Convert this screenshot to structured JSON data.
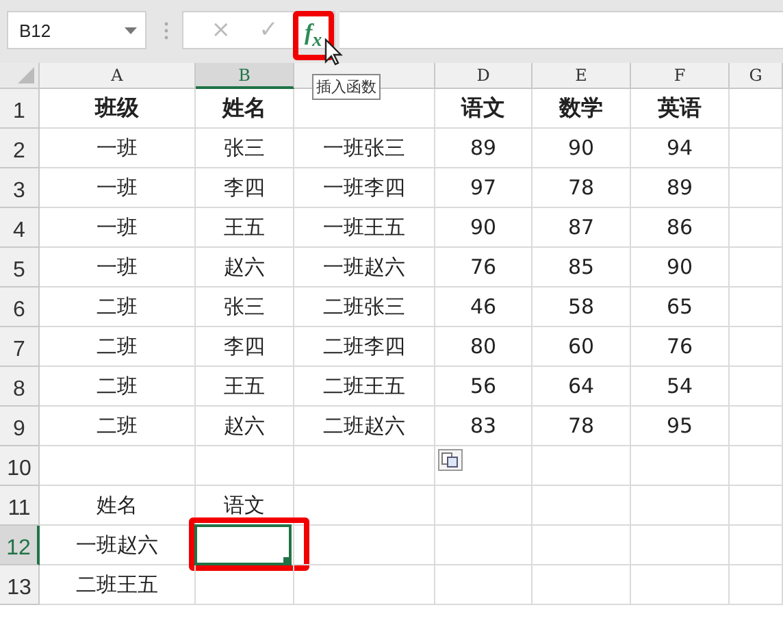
{
  "name_box": {
    "value": "B12"
  },
  "formula_bar": {
    "cancel": "×",
    "enter": "✓",
    "function_button": {
      "label": "f$_{x}$",
      "highlighted": true
    },
    "tooltip": "插入函数"
  },
  "selection": {
    "highlighted": true
  },
  "columns": [
    {
      "label": "A",
      "selected": false
    },
    {
      "label": "B",
      "selected": true
    },
    {
      "selected": false
    },
    {
      "label": "D",
      "selected": false
    },
    {
      "label": "E",
      "selected": false
    },
    {
      "label": "F",
      "selected": false
    },
    {
      "label": "G",
      "selected": false
    }
  ],
  "rows": [
    {
      "number": "1",
      "selected": false,
      "kind": "header",
      "cells": [
        "班级",
        "姓名",
        null,
        "语文",
        "数学",
        "英语",
        null
      ]
    },
    {
      "number": "2",
      "selected": false,
      "kind": "data",
      "cells": [
        "一班",
        "张三",
        "一班张三",
        "89",
        "90",
        "94",
        null
      ]
    },
    {
      "number": "3",
      "selected": false,
      "kind": "data",
      "cells": [
        "一班",
        "李四",
        "一班李四",
        "97",
        "78",
        "89",
        null
      ]
    },
    {
      "number": "4",
      "selected": false,
      "kind": "data",
      "cells": [
        "一班",
        "王五",
        "一班王五",
        "90",
        "87",
        "86",
        null
      ]
    },
    {
      "number": "5",
      "selected": false,
      "kind": "data",
      "cells": [
        "一班",
        "赵六",
        "一班赵六",
        "76",
        "85",
        "90",
        null
      ]
    },
    {
      "number": "6",
      "selected": false,
      "kind": "data",
      "cells": [
        "二班",
        "张三",
        "二班张三",
        "46",
        "58",
        "65",
        null
      ]
    },
    {
      "number": "7",
      "selected": false,
      "kind": "data",
      "cells": [
        "二班",
        "李四",
        "二班李四",
        "80",
        "60",
        "76",
        null
      ]
    },
    {
      "number": "8",
      "selected": false,
      "kind": "data",
      "cells": [
        "二班",
        "王五",
        "二班王五",
        "56",
        "64",
        "54",
        null
      ]
    },
    {
      "number": "9",
      "selected": false,
      "kind": "data",
      "cells": [
        "二班",
        "赵六",
        "二班赵六",
        "83",
        "78",
        "95",
        null
      ]
    },
    {
      "number": "10",
      "selected": false,
      "kind": "data",
      "cells": [
        null,
        null,
        null,
        null,
        null,
        null,
        null
      ]
    },
    {
      "number": "11",
      "selected": false,
      "kind": "data",
      "cells": [
        "姓名",
        "语文",
        null,
        null,
        null,
        null,
        null
      ]
    },
    {
      "number": "12",
      "selected": true,
      "kind": "data",
      "cells": [
        "一班赵六",
        null,
        null,
        null,
        null,
        null,
        null
      ]
    },
    {
      "number": "13",
      "selected": false,
      "kind": "data",
      "cells": [
        "二班王五",
        null,
        null,
        null,
        null,
        null,
        null
      ]
    }
  ]
}
